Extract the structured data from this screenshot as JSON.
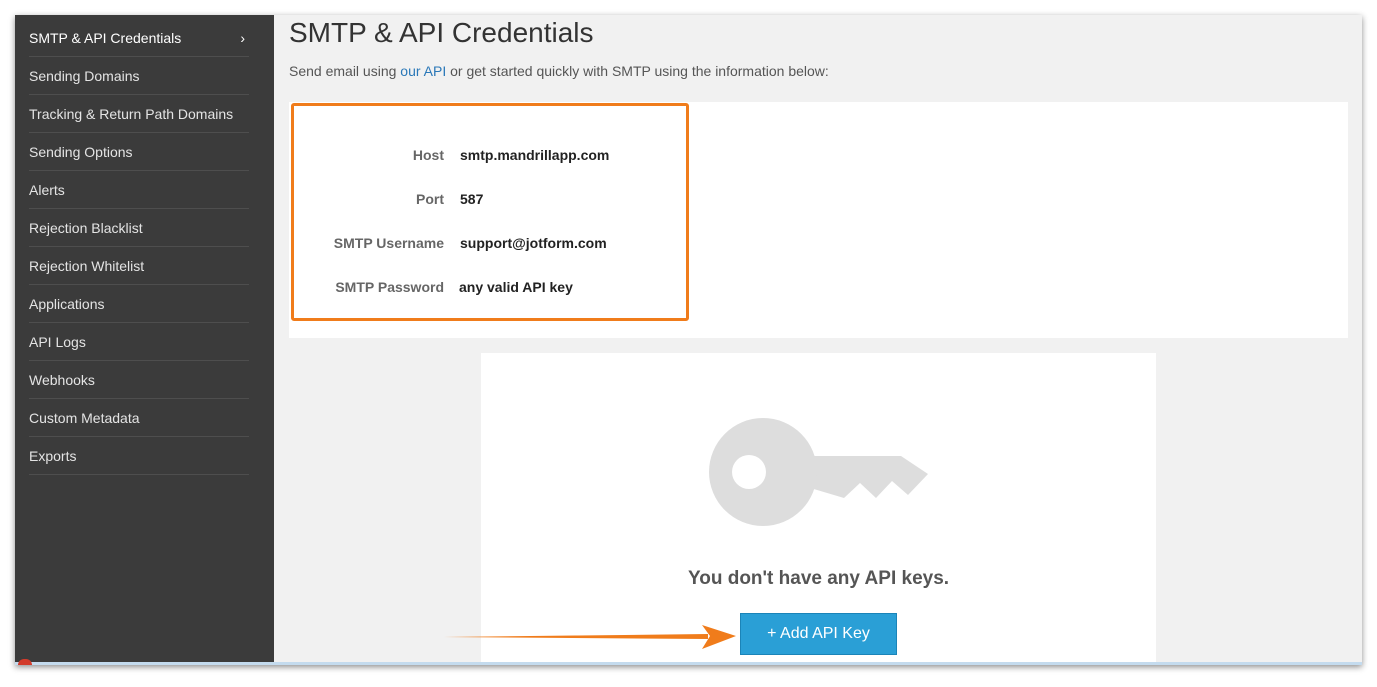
{
  "sidebar": {
    "items": [
      {
        "label": "SMTP & API Credentials",
        "active": true
      },
      {
        "label": "Sending Domains"
      },
      {
        "label": "Tracking & Return Path Domains"
      },
      {
        "label": "Sending Options"
      },
      {
        "label": "Alerts"
      },
      {
        "label": "Rejection Blacklist"
      },
      {
        "label": "Rejection Whitelist"
      },
      {
        "label": "Applications"
      },
      {
        "label": "API Logs"
      },
      {
        "label": "Webhooks"
      },
      {
        "label": "Custom Metadata"
      },
      {
        "label": "Exports"
      }
    ],
    "active_chevron": "›"
  },
  "page": {
    "title": "SMTP & API Credentials",
    "subtitle_before": "Send email using ",
    "subtitle_link": "our API",
    "subtitle_after": " or get started quickly with SMTP using the information below:"
  },
  "credentials": {
    "host_label": "Host",
    "host_value": "smtp.mandrillapp.com",
    "port_label": "Port",
    "port_value": "587",
    "username_label": "SMTP Username",
    "username_value": "support@jotform.com",
    "password_label": "SMTP Password",
    "password_value": "any valid API key"
  },
  "api_keys": {
    "empty_message": "You don't have any API keys.",
    "add_button": "+ Add API Key",
    "icon": "key-icon"
  },
  "colors": {
    "sidebar_bg": "#3b3b3b",
    "highlight_orange": "#f07c1b",
    "button_blue": "#2a9fd6",
    "link_blue": "#2a78b8"
  }
}
